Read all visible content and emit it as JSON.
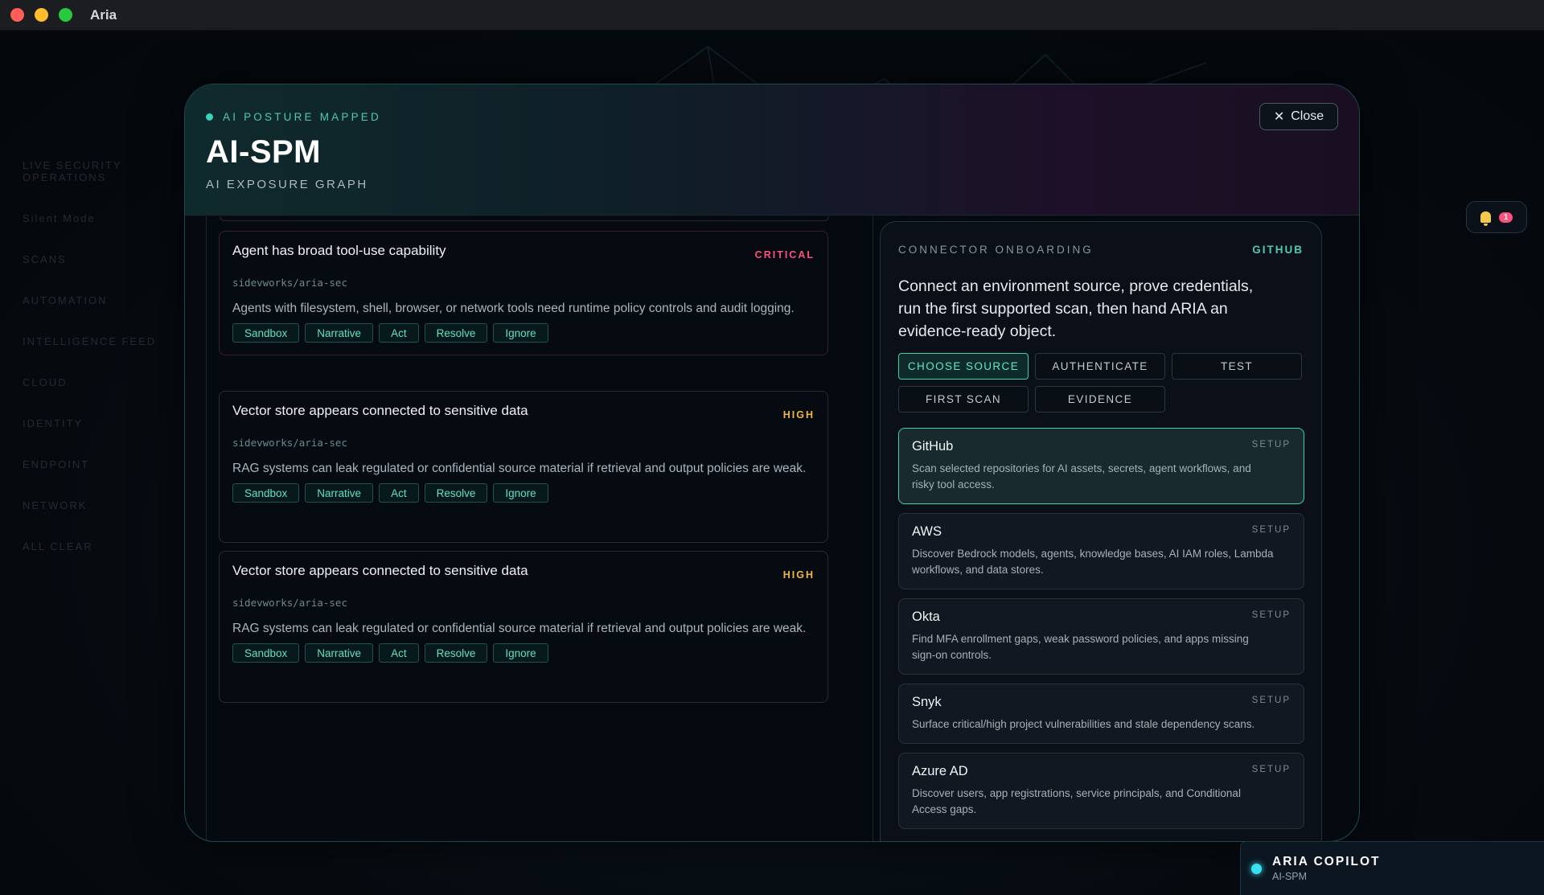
{
  "window": {
    "title": "Aria"
  },
  "background": {
    "sidebar_rows": [
      "LIVE SECURITY OPERATIONS",
      "Silent Mode",
      "SCANS",
      "AUTOMATION",
      "INTELLIGENCE FEED",
      "CLOUD",
      "IDENTITY",
      "ENDPOINT",
      "NETWORK",
      "ALL CLEAR"
    ],
    "notifications": {
      "count": "1"
    }
  },
  "modal": {
    "eyebrow": "AI POSTURE MAPPED",
    "title": "AI-SPM",
    "subtitle": "AI EXPOSURE GRAPH",
    "close_label": "Close"
  },
  "findings": [
    {
      "title": "Agent has broad tool-use capability",
      "severity": "CRITICAL",
      "repo": "sidevworks/aria-sec",
      "description": "Agents with filesystem, shell, browser, or network tools need runtime policy controls and audit logging.",
      "actions": [
        "Sandbox",
        "Narrative",
        "Act",
        "Resolve",
        "Ignore"
      ]
    },
    {
      "title": "Vector store appears connected to sensitive data",
      "severity": "HIGH",
      "repo": "sidevworks/aria-sec",
      "description": "RAG systems can leak regulated or confidential source material if retrieval and output policies are weak.",
      "actions": [
        "Sandbox",
        "Narrative",
        "Act",
        "Resolve",
        "Ignore"
      ]
    },
    {
      "title": "Vector store appears connected to sensitive data",
      "severity": "HIGH",
      "repo": "sidevworks/aria-sec",
      "description": "RAG systems can leak regulated or confidential source material if retrieval and output policies are weak.",
      "actions": [
        "Sandbox",
        "Narrative",
        "Act",
        "Resolve",
        "Ignore"
      ]
    }
  ],
  "connector": {
    "label": "CONNECTOR ONBOARDING",
    "provider": "GITHUB",
    "intro": "Connect an environment source, prove credentials, run the first supported scan, then hand ARIA an evidence-ready object.",
    "steps": [
      "CHOOSE SOURCE",
      "AUTHENTICATE",
      "TEST",
      "FIRST SCAN",
      "EVIDENCE"
    ],
    "active_step": "CHOOSE SOURCE",
    "sources": [
      {
        "name": "GitHub",
        "tag": "SETUP",
        "description": "Scan selected repositories for AI assets, secrets, agent workflows, and risky tool access."
      },
      {
        "name": "AWS",
        "tag": "SETUP",
        "description": "Discover Bedrock models, agents, knowledge bases, AI IAM roles, Lambda workflows, and data stores."
      },
      {
        "name": "Okta",
        "tag": "SETUP",
        "description": "Find MFA enrollment gaps, weak password policies, and apps missing sign-on controls."
      },
      {
        "name": "Snyk",
        "tag": "SETUP",
        "description": "Surface critical/high project vulnerabilities and stale dependency scans."
      },
      {
        "name": "Azure AD",
        "tag": "SETUP",
        "description": "Discover users, app registrations, service principals, and Conditional Access gaps."
      }
    ]
  },
  "copilot": {
    "title": "ARIA COPILOT",
    "subtitle": "AI-SPM"
  },
  "colors": {
    "accent": "#3ecfb2",
    "critical": "#ff4f7b",
    "high": "#f2b544",
    "copilot": "#3ae0f0"
  }
}
